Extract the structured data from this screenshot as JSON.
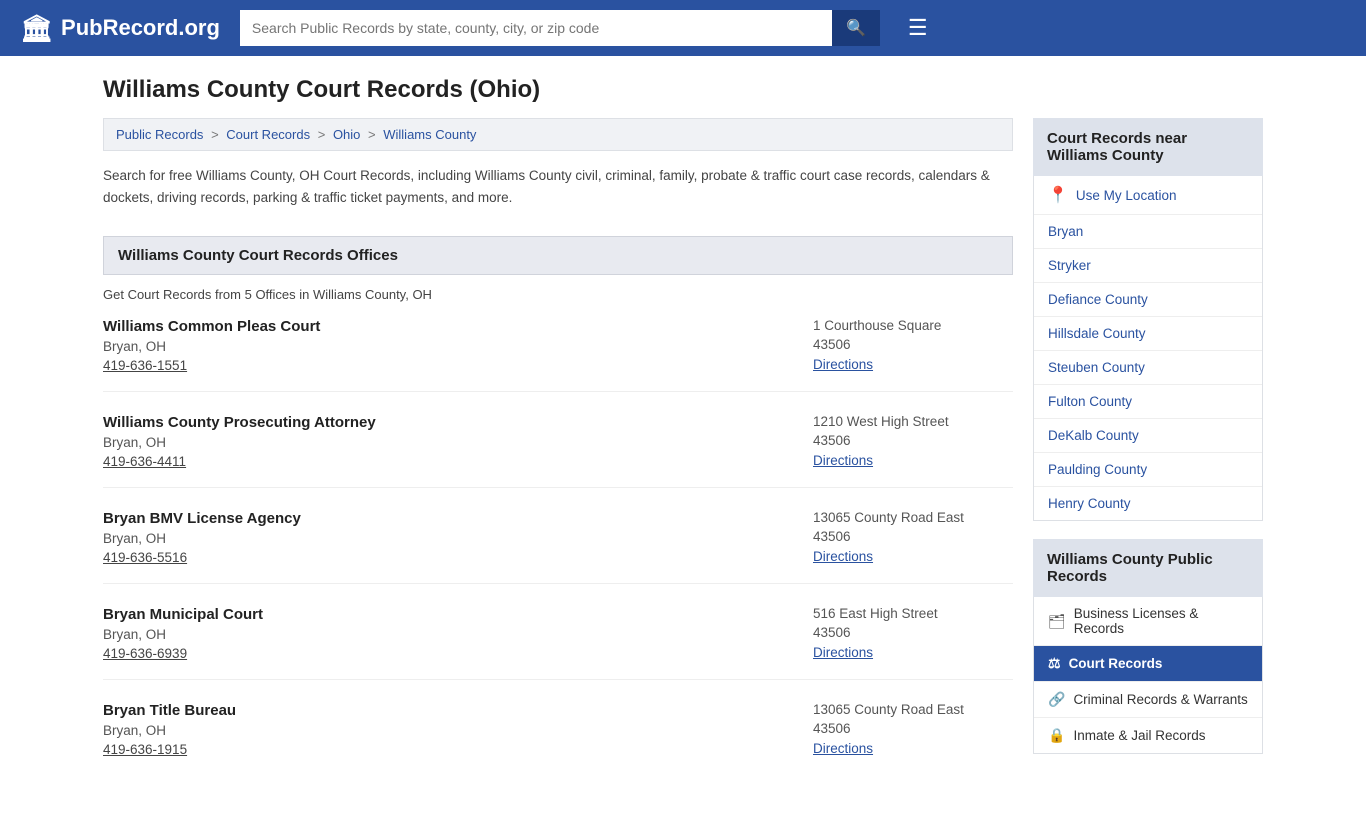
{
  "header": {
    "logo_text": "PubRecord.org",
    "logo_icon": "🏛",
    "search_placeholder": "Search Public Records by state, county, city, or zip code",
    "search_icon": "🔍",
    "menu_icon": "☰"
  },
  "page": {
    "title": "Williams County Court Records (Ohio)",
    "breadcrumb": [
      {
        "label": "Public Records",
        "href": "#"
      },
      {
        "label": "Court Records",
        "href": "#"
      },
      {
        "label": "Ohio",
        "href": "#"
      },
      {
        "label": "Williams County",
        "href": "#"
      }
    ],
    "description": "Search for free Williams County, OH Court Records, including Williams County civil, criminal, family, probate & traffic court case records, calendars & dockets, driving records, parking & traffic ticket payments, and more.",
    "offices_section_header": "Williams County Court Records Offices",
    "offices_count_text": "Get Court Records from 5 Offices in Williams County, OH",
    "offices": [
      {
        "name": "Williams Common Pleas Court",
        "city": "Bryan, OH",
        "phone": "419-636-1551",
        "address": "1 Courthouse Square",
        "zip": "43506",
        "directions_label": "Directions"
      },
      {
        "name": "Williams County Prosecuting Attorney",
        "city": "Bryan, OH",
        "phone": "419-636-4411",
        "address": "1210 West High Street",
        "zip": "43506",
        "directions_label": "Directions"
      },
      {
        "name": "Bryan BMV License Agency",
        "city": "Bryan, OH",
        "phone": "419-636-5516",
        "address": "13065 County Road East",
        "zip": "43506",
        "directions_label": "Directions"
      },
      {
        "name": "Bryan Municipal Court",
        "city": "Bryan, OH",
        "phone": "419-636-6939",
        "address": "516 East High Street",
        "zip": "43506",
        "directions_label": "Directions"
      },
      {
        "name": "Bryan Title Bureau",
        "city": "Bryan, OH",
        "phone": "419-636-1915",
        "address": "13065 County Road East",
        "zip": "43506",
        "directions_label": "Directions"
      }
    ]
  },
  "sidebar": {
    "nearby_header": "Court Records near Williams County",
    "use_location_label": "Use My Location",
    "nearby_links": [
      {
        "label": "Bryan"
      },
      {
        "label": "Stryker"
      },
      {
        "label": "Defiance County"
      },
      {
        "label": "Hillsdale County"
      },
      {
        "label": "Steuben County"
      },
      {
        "label": "Fulton County"
      },
      {
        "label": "DeKalb County"
      },
      {
        "label": "Paulding County"
      },
      {
        "label": "Henry County"
      }
    ],
    "public_records_header": "Williams County Public Records",
    "public_records_links": [
      {
        "label": "Business Licenses & Records",
        "icon": "🗂",
        "active": false
      },
      {
        "label": "Court Records",
        "icon": "⚖",
        "active": true
      },
      {
        "label": "Criminal Records & Warrants",
        "icon": "🔗",
        "active": false
      },
      {
        "label": "Inmate & Jail Records",
        "icon": "🔒",
        "active": false
      }
    ]
  }
}
